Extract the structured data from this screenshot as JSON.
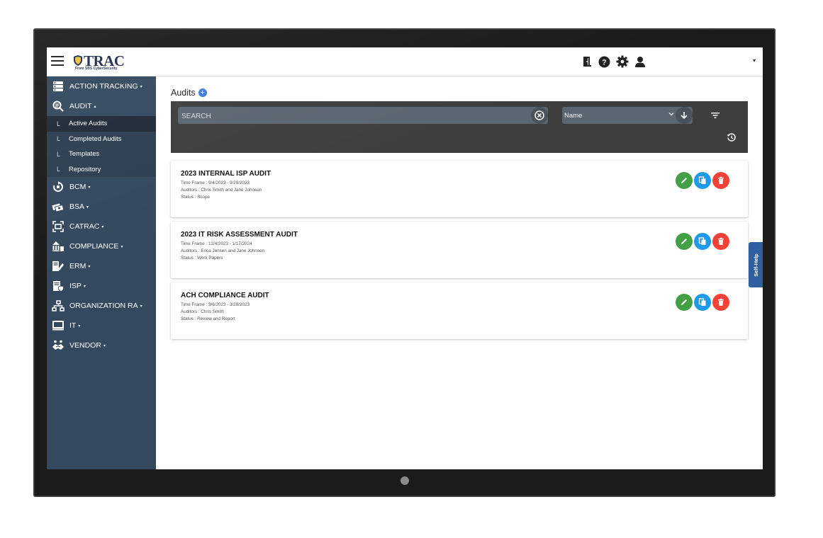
{
  "brand": {
    "name": "TRAC",
    "subtitle": "From SBS CyberSecurity"
  },
  "topbar": {
    "icons": [
      "exit-door-icon",
      "help-icon",
      "gear-icon",
      "user-icon"
    ],
    "caret": "▾"
  },
  "sidebar": {
    "items": [
      {
        "label": "ACTION TRACKING",
        "icon": "list-icon",
        "caret": "▾"
      },
      {
        "label": "AUDIT",
        "icon": "audit-magnifier-icon",
        "caret": "▴"
      },
      {
        "label": "BCM",
        "icon": "bcm-icon",
        "caret": "▾"
      },
      {
        "label": "BSA",
        "icon": "bsa-icon",
        "caret": "▾"
      },
      {
        "label": "CATRAC",
        "icon": "catrac-icon",
        "caret": "▾"
      },
      {
        "label": "COMPLIANCE",
        "icon": "compliance-icon",
        "caret": "▾"
      },
      {
        "label": "ERM",
        "icon": "erm-icon",
        "caret": "▾"
      },
      {
        "label": "ISP",
        "icon": "isp-icon",
        "caret": "▾"
      },
      {
        "label": "ORGANIZATION RA",
        "icon": "organization-icon",
        "caret": "▾"
      },
      {
        "label": "IT",
        "icon": "monitor-icon",
        "caret": "▾"
      },
      {
        "label": "VENDOR",
        "icon": "handshake-icon",
        "caret": "▾"
      }
    ],
    "audit_sub": [
      {
        "label": "Active Audits",
        "active": true
      },
      {
        "label": "Completed Audits",
        "active": false
      },
      {
        "label": "Templates",
        "active": false
      },
      {
        "label": "Repository",
        "active": false
      }
    ],
    "sub_prefix": "L"
  },
  "main": {
    "title": "Audits",
    "search": {
      "placeholder": "SEARCH",
      "value": ""
    },
    "sort": {
      "value": "Name"
    }
  },
  "audits": [
    {
      "title": "2023 INTERNAL ISP AUDIT",
      "time_frame": "Time Frame : 9/4/2023 - 9/29/2023",
      "auditors": "Auditors : Chris Smith and Jane Johnson",
      "status": "Status : Scope"
    },
    {
      "title": "2023 IT RISK ASSESSMENT AUDIT",
      "time_frame": "Time Frame : 12/4/2023 - 1/17/2024",
      "auditors": "Auditors : Erica Jensen and Jane Johnson",
      "status": "Status : Work Papers"
    },
    {
      "title": "ACH COMPLIANCE AUDIT",
      "time_frame": "Time Frame : 3/6/2023 - 3/28/2023",
      "auditors": "Auditors : Chris Smith",
      "status": "Status : Review and Report"
    }
  ],
  "actions": {
    "edit_color": "#43a047",
    "copy_color": "#1e9be8",
    "delete_color": "#f44336"
  },
  "self_help": {
    "label": "Self-Help"
  },
  "colors": {
    "sidebar": "#34495e",
    "filterbar": "#3e3e3e",
    "accent": "#3f7ad6"
  }
}
